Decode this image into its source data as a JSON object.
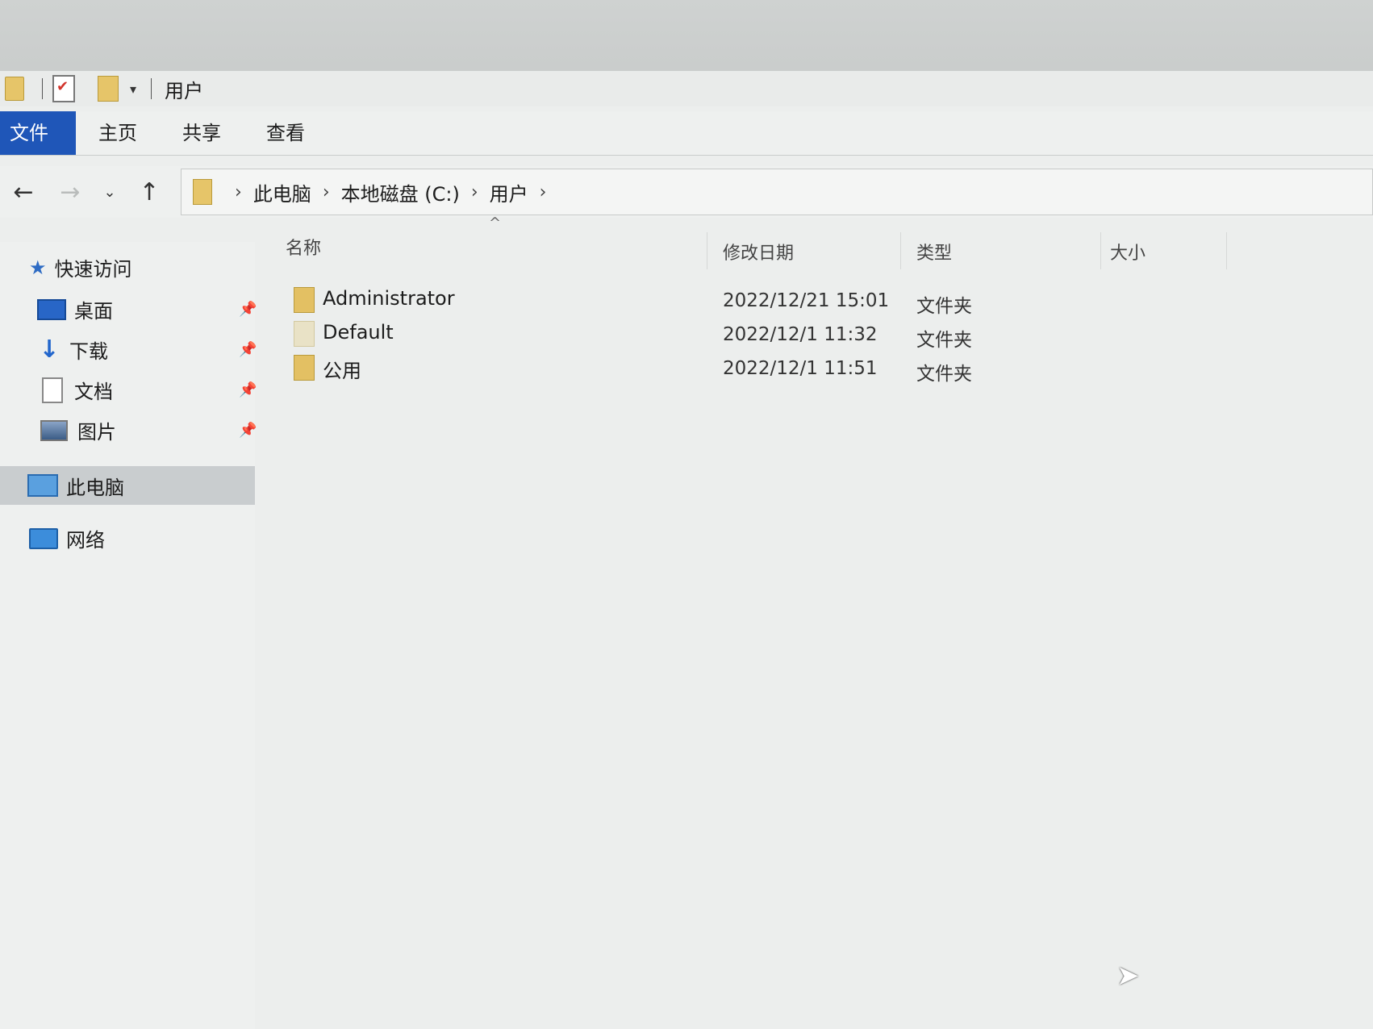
{
  "window": {
    "title": "用户"
  },
  "ribbon": {
    "tabs": [
      "文件",
      "主页",
      "共享",
      "查看"
    ]
  },
  "address": {
    "crumbs": [
      "此电脑",
      "本地磁盘 (C:)",
      "用户"
    ]
  },
  "sidebar": {
    "quick_access": "快速访问",
    "pinned": [
      "桌面",
      "下载",
      "文档",
      "图片"
    ],
    "this_pc": "此电脑",
    "network": "网络"
  },
  "columns": {
    "name": "名称",
    "date": "修改日期",
    "type": "类型",
    "size": "大小"
  },
  "files": [
    {
      "name": "Administrator",
      "date": "2022/12/21 15:01",
      "type": "文件夹"
    },
    {
      "name": "Default",
      "date": "2022/12/1 11:32",
      "type": "文件夹"
    },
    {
      "name": "公用",
      "date": "2022/12/1 11:51",
      "type": "文件夹"
    }
  ],
  "icons": {
    "back": "arrow-left-icon",
    "forward": "arrow-right-icon",
    "recent": "chevron-down-icon",
    "up": "arrow-up-icon"
  }
}
